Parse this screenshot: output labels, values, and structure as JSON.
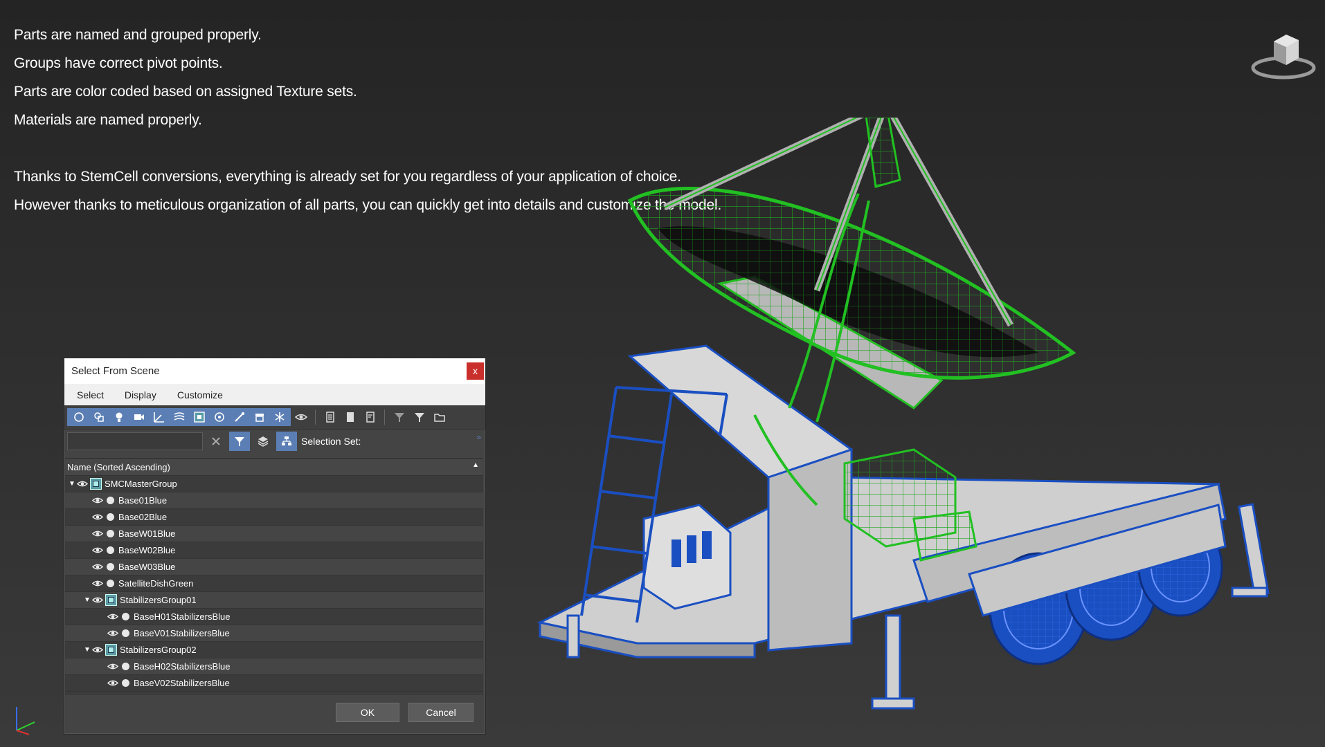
{
  "notes": [
    "Parts are named and grouped properly.",
    "Groups have correct pivot points.",
    "Parts are color coded based on assigned Texture sets.",
    "Materials are named properly.",
    "Thanks to StemCell conversions, everything is already set for you regardless  of your application of choice.",
    "However thanks to meticulous organization of all parts, you can quickly get into details and customize the model."
  ],
  "colors": {
    "green": "#22c022",
    "blue": "#1a4fc2",
    "accent": "#5b7fb5",
    "close": "#c9302c"
  },
  "dialog": {
    "title": "Select From Scene",
    "close_label": "x",
    "menu": [
      "Select",
      "Display",
      "Customize"
    ],
    "search": {
      "value": ""
    },
    "selection_set_label": "Selection Set:",
    "column_header": "Name (Sorted Ascending)",
    "items": [
      {
        "label": "SMCMasterGroup",
        "type": "group",
        "level": 0
      },
      {
        "label": "Base01Blue",
        "type": "object",
        "level": 1
      },
      {
        "label": "Base02Blue",
        "type": "object",
        "level": 1
      },
      {
        "label": "BaseW01Blue",
        "type": "object",
        "level": 1
      },
      {
        "label": "BaseW02Blue",
        "type": "object",
        "level": 1
      },
      {
        "label": "BaseW03Blue",
        "type": "object",
        "level": 1
      },
      {
        "label": "SatelliteDishGreen",
        "type": "object",
        "level": 1
      },
      {
        "label": "StabilizersGroup01",
        "type": "group",
        "level": 1
      },
      {
        "label": "BaseH01StabilizersBlue",
        "type": "object",
        "level": 2
      },
      {
        "label": "BaseV01StabilizersBlue",
        "type": "object",
        "level": 2
      },
      {
        "label": "StabilizersGroup02",
        "type": "group",
        "level": 1
      },
      {
        "label": "BaseH02StabilizersBlue",
        "type": "object",
        "level": 2
      },
      {
        "label": "BaseV02StabilizersBlue",
        "type": "object",
        "level": 2
      }
    ],
    "ok_label": "OK",
    "cancel_label": "Cancel"
  }
}
